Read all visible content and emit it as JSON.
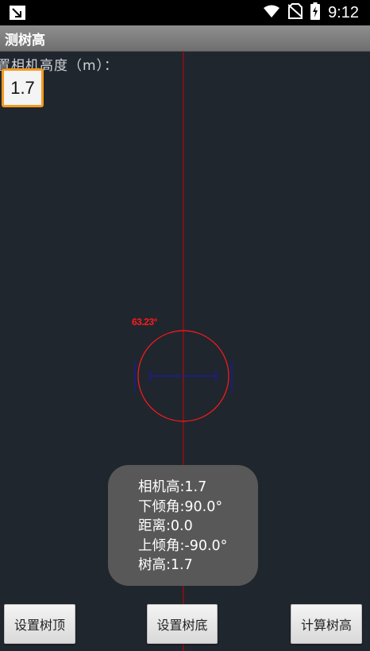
{
  "status_bar": {
    "time": "9:12",
    "icons": [
      "notification-icon",
      "wifi-icon",
      "no-sim-icon",
      "battery-charging-icon"
    ]
  },
  "app_bar": {
    "title": "测树高"
  },
  "camera_height": {
    "label": "置相机高度（m）：",
    "value": "1.7"
  },
  "overlay": {
    "angle_label": "63.23°",
    "colors": {
      "line": "#d40000",
      "circle": "#ff1a1a",
      "scale": "#1a1aa8"
    }
  },
  "toast": {
    "lines": [
      "相机高:1.7",
      "下倾角:90.0°",
      "距离:0.0",
      "上倾角:-90.0°",
      "树高:1.7"
    ]
  },
  "buttons": {
    "set_top": "设置树顶",
    "set_bottom": "设置树底",
    "calculate": "计算树高"
  }
}
